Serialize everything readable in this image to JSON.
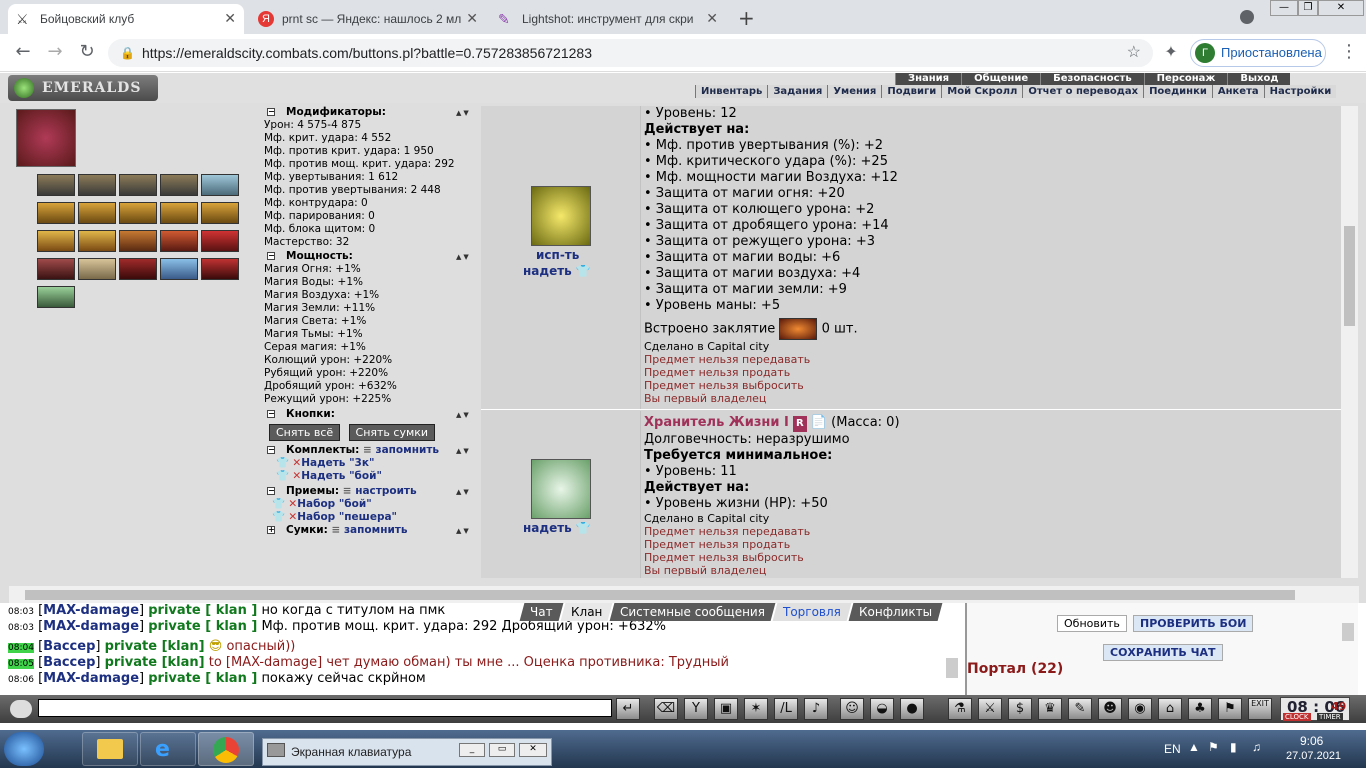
{
  "browser": {
    "tabs": [
      {
        "title": "Бойцовский клуб",
        "active": true
      },
      {
        "title": "prnt sc — Яндекс: нашлось 2 млн",
        "active": false
      },
      {
        "title": "Lightshot: инструмент для скри",
        "active": false
      }
    ],
    "new_tab": "+",
    "url": "https://emeraldscity.combats.com/buttons.pl?battle=0.757283856721283",
    "paused_label": "Приостановлена",
    "profile_initial": "Г",
    "window_min": "—",
    "window_restore": "❐",
    "window_close": "✕"
  },
  "game": {
    "logo": "EMERALDS",
    "top_menu": [
      "Знания",
      "Общение",
      "Безопасность",
      "Персонаж",
      "Выход"
    ],
    "sub_menu": [
      "Инвентарь",
      "Задания",
      "Умения",
      "Подвиги",
      "Мой Скролл",
      "Отчет о переводах",
      "Поединки",
      "Анкета",
      "Настройки"
    ]
  },
  "mods": {
    "modifiers_title": "Модификаторы:",
    "modifiers": [
      "Урон: 4 575-4 875",
      "Мф. крит. удара: 4 552",
      "Мф. против крит. удара: 1 950",
      "Мф. против мощ. крит. удара: 292",
      "Мф. увертывания: 1 612",
      "Мф. против увертывания: 2 448",
      "Мф. контрудара: 0",
      "Мф. парирования: 0",
      "Мф. блока щитом: 0",
      "Мастерство: 32"
    ],
    "power_title": "Мощность:",
    "power": [
      "Магия Огня: +1%",
      "Магия Воды: +1%",
      "Магия Воздуха: +1%",
      "Магия Земли: +11%",
      "Магия Света: +1%",
      "Магия Тьмы: +1%",
      "Серая магия: +1%",
      "Колющий урон: +220%",
      "Рубящий урон: +220%",
      "Дробящий урон: +632%",
      "Режущий урон: +225%"
    ],
    "buttons_title": "Кнопки:",
    "btn_remove_all": "Снять всё",
    "btn_remove_bags": "Снять сумки",
    "sets_title": "Комплекты:",
    "sets_remember": "запомнить",
    "sets": [
      "Надеть \"3к\"",
      "Надеть \"бой\""
    ],
    "techniques_title": "Приемы:",
    "techniques_configure": "настроить",
    "techniques": [
      "Набор \"бой\"",
      "Набор \"пешера\""
    ],
    "bags_title": "Сумки:",
    "bags_remember": "запомнить"
  },
  "items": {
    "item1": {
      "use_link": "исп-ть",
      "wear_link": "надеть",
      "level_line": "• Уровень: 12",
      "acts_title": "Действует на:",
      "effects": [
        "• Мф. против увертывания (%): +2",
        "• Мф. критического удара (%): +25",
        "• Мф. мощности магии Воздуха: +12",
        "• Защита от магии огня: +20",
        "• Защита от колющего урона: +2",
        "• Защита от дробящего урона: +14",
        "• Защита от режущего урона: +3",
        "• Защита от магии воды: +6",
        "• Защита от магии воздуха: +4",
        "• Защита от магии земли: +9",
        "• Уровень маны: +5"
      ],
      "spell_label": "Встроено заклятие",
      "spell_count": "0 шт.",
      "made_in": "Сделано в Capital city",
      "restrictions": [
        "Предмет нельзя передавать",
        "Предмет нельзя продать",
        "Предмет нельзя выбросить",
        "Вы первый владелец"
      ]
    },
    "item2": {
      "wear_link": "надеть",
      "name": "Хранитель Жизни I",
      "rune": "R",
      "mass": "(Масса: 0)",
      "durability": "Долговечность: неразрушимо",
      "req_title": "Требуется минимальное:",
      "req_level": "• Уровень: 11",
      "acts_title": "Действует на:",
      "effect": "• Уровень жизни (HP): +50",
      "made_in": "Сделано в Capital city",
      "restrictions": [
        "Предмет нельзя передавать",
        "Предмет нельзя продать",
        "Предмет нельзя выбросить",
        "Вы первый владелец"
      ]
    }
  },
  "chat": {
    "tabs": [
      "Чат",
      "Клан",
      "Системные сообщения",
      "Торговля",
      "Конфликты"
    ],
    "lines": [
      {
        "time": "08:03",
        "name": "MAX-damage",
        "chan": "private [ klan ]",
        "text": "но когда с титулом на пмк"
      },
      {
        "time": "08:03",
        "name": "MAX-damage",
        "chan": "private [ klan ]",
        "text": "Мф. против мощ. крит. удара: 292 Дробящий урон: +632%"
      },
      {
        "time": "08:04",
        "name": "Вассер",
        "chan": "private [klan]",
        "text": "опасный))"
      },
      {
        "time": "08:05",
        "name": "Вассер",
        "chan": "private [klan]",
        "text": "to [MAX-damage] чет думаю обман) ты мне ... Оценка противника: Трудный"
      },
      {
        "time": "08:06",
        "name": "MAX-damage",
        "chan": "private [ klan ]",
        "text": "покажу сейчас скрйном"
      }
    ],
    "btn_refresh": "Обновить",
    "btn_check_fights": "ПРОВЕРИТЬ БОИ",
    "btn_save_chat": "СОХРАНИТЬ ЧАТ",
    "portal": "Портал (22)"
  },
  "toolbar": {
    "clock": "08 : 06",
    "seconds": "49",
    "clock_label": "CLOCK",
    "timer_label": "TIMER",
    "exit": "EXIT"
  },
  "taskbar": {
    "osk": "Экранная клавиатура",
    "lang": "EN",
    "time": "9:06",
    "date": "27.07.2021"
  }
}
